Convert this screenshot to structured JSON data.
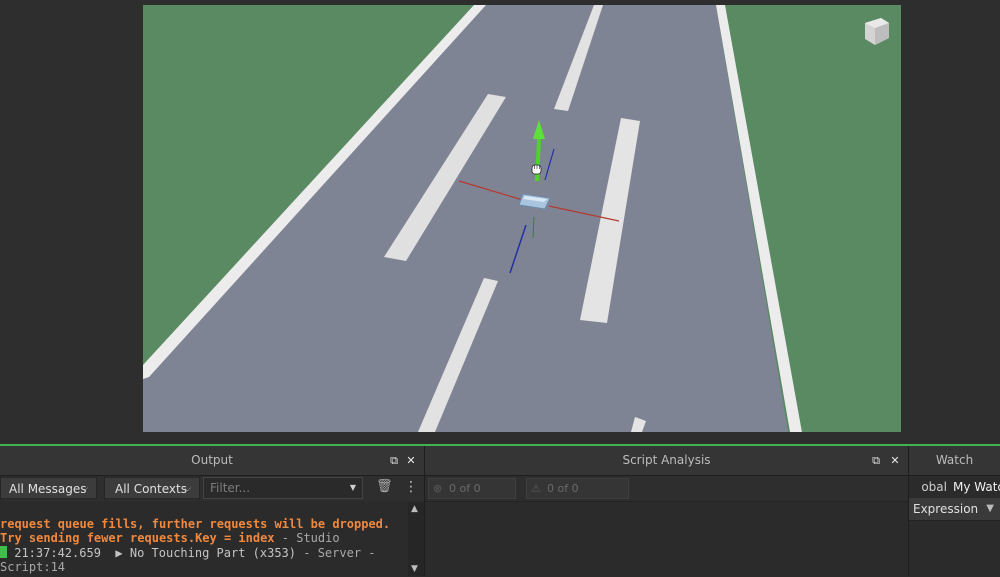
{
  "output": {
    "title": "Output",
    "messages_filter": "All Messages",
    "contexts_filter": "All Contexts",
    "filter_placeholder": "Filter...",
    "log": [
      {
        "text": "request queue fills, further requests will be dropped.",
        "kind": "warning"
      },
      {
        "text": "Try sending fewer requests.Key = index",
        "kind": "warning",
        "context": "Studio"
      },
      {
        "time": "21:37:42.659",
        "text": "▶ No Touching Part (x353)",
        "context": "Server",
        "source": "Script:14"
      }
    ],
    "log_separator": " - ",
    "log_trailing_separator": " -"
  },
  "analysis": {
    "title": "Script Analysis",
    "errors_label": "0 of 0 Errors",
    "warnings_label": "0 of 0 Warnings"
  },
  "watch": {
    "title": "Watch",
    "tab_global": "Global",
    "tab_global_visible": "obal",
    "tab_my": "My Watch",
    "column": "Expression"
  },
  "colors": {
    "accent": "#40b34a",
    "warning": "#f0883e",
    "grass": "#5a8a62",
    "road": "#7f8494"
  }
}
